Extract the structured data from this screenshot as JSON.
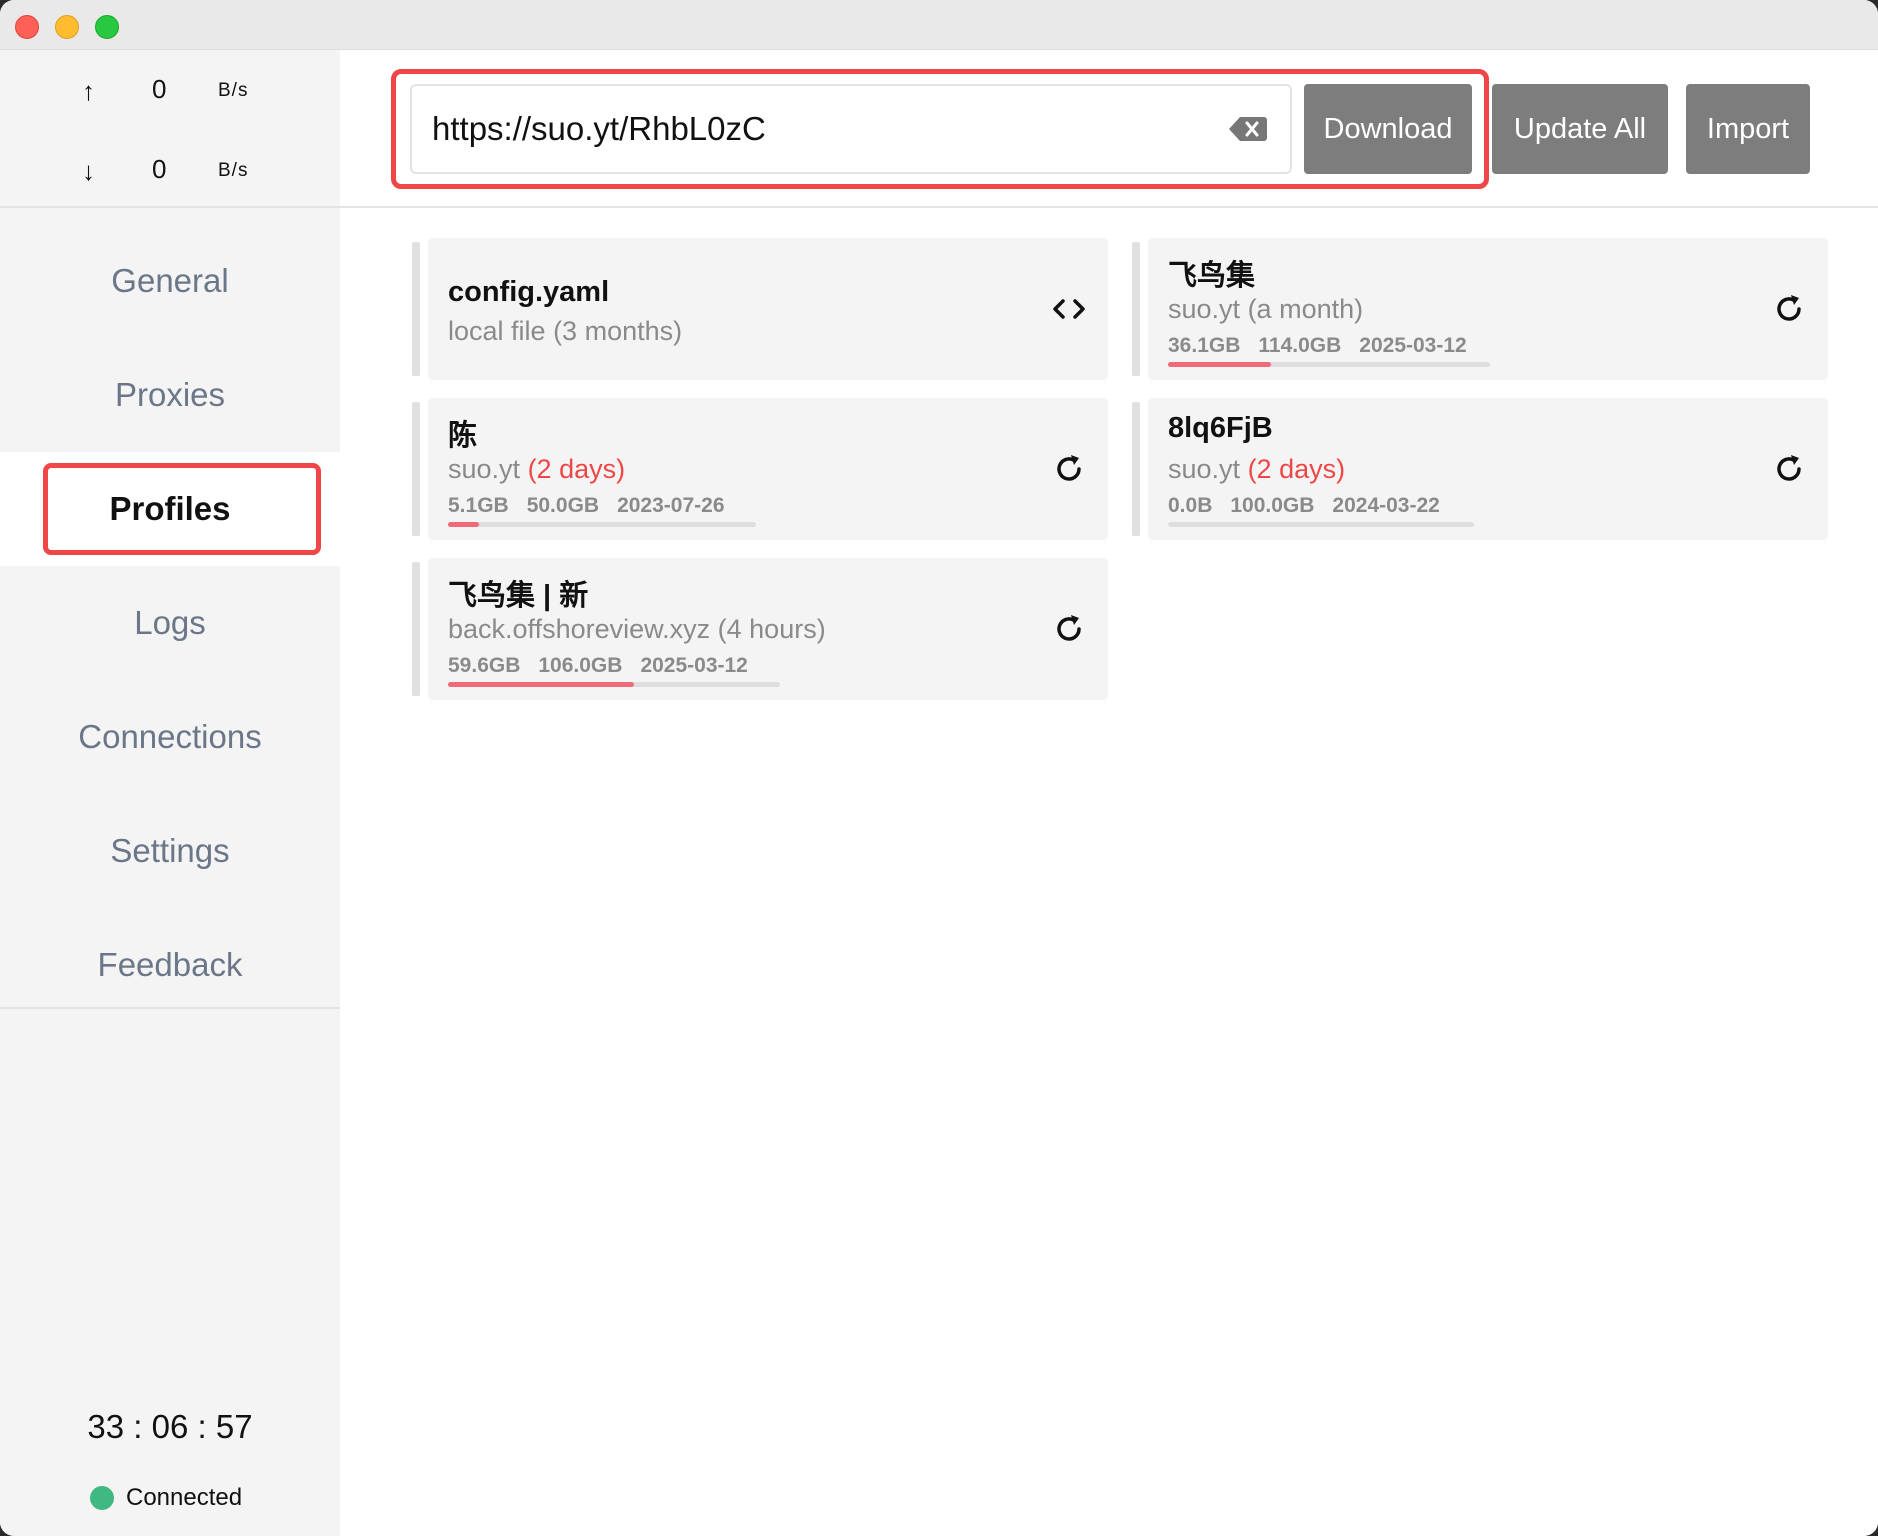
{
  "window": {
    "buttons": [
      "close",
      "minimize",
      "maximize"
    ]
  },
  "traffic": {
    "up": {
      "arrow": "↑",
      "value": "0",
      "unit": "B/s"
    },
    "down": {
      "arrow": "↓",
      "value": "0",
      "unit": "B/s"
    }
  },
  "nav": {
    "items": [
      {
        "label": "General"
      },
      {
        "label": "Proxies"
      },
      {
        "label": "Profiles",
        "active": true
      },
      {
        "label": "Logs"
      },
      {
        "label": "Connections"
      },
      {
        "label": "Settings"
      },
      {
        "label": "Feedback"
      }
    ]
  },
  "footer": {
    "timer": "33 : 06 : 57",
    "status": "Connected",
    "status_color": "#3fb97f"
  },
  "toolbar": {
    "url_value": "https://suo.yt/RhbL0zC",
    "download_label": "Download",
    "update_all_label": "Update All",
    "import_label": "Import"
  },
  "profiles": [
    {
      "title": "config.yaml",
      "source": "local file",
      "age": "(3 months)",
      "age_warning": false,
      "icon": "code-icon"
    },
    {
      "title": "飞鸟集",
      "source": "suo.yt",
      "age": "(a month)",
      "age_warning": false,
      "used": "36.1GB",
      "total": "114.0GB",
      "expire": "2025-03-12",
      "usage_fraction": 0.32,
      "icon": "refresh-icon"
    },
    {
      "title": "陈",
      "source": "suo.yt",
      "age": "(2 days)",
      "age_warning": true,
      "used": "5.1GB",
      "total": "50.0GB",
      "expire": "2023-07-26",
      "usage_fraction": 0.1,
      "icon": "refresh-icon"
    },
    {
      "title": "8lq6FjB",
      "source": "suo.yt",
      "age": "(2 days)",
      "age_warning": true,
      "used": "0.0B",
      "total": "100.0GB",
      "expire": "2024-03-22",
      "usage_fraction": 0.0,
      "icon": "refresh-icon"
    },
    {
      "title": "飞鸟集 | 新",
      "source": "back.offshoreview.xyz",
      "age": "(4 hours)",
      "age_warning": false,
      "used": "59.6GB",
      "total": "106.0GB",
      "expire": "2025-03-12",
      "usage_fraction": 0.56,
      "icon": "refresh-icon"
    }
  ],
  "colors": {
    "highlight": "#ef4747",
    "usage_bar": "#ef6b7a",
    "button": "#7d7d7d"
  }
}
